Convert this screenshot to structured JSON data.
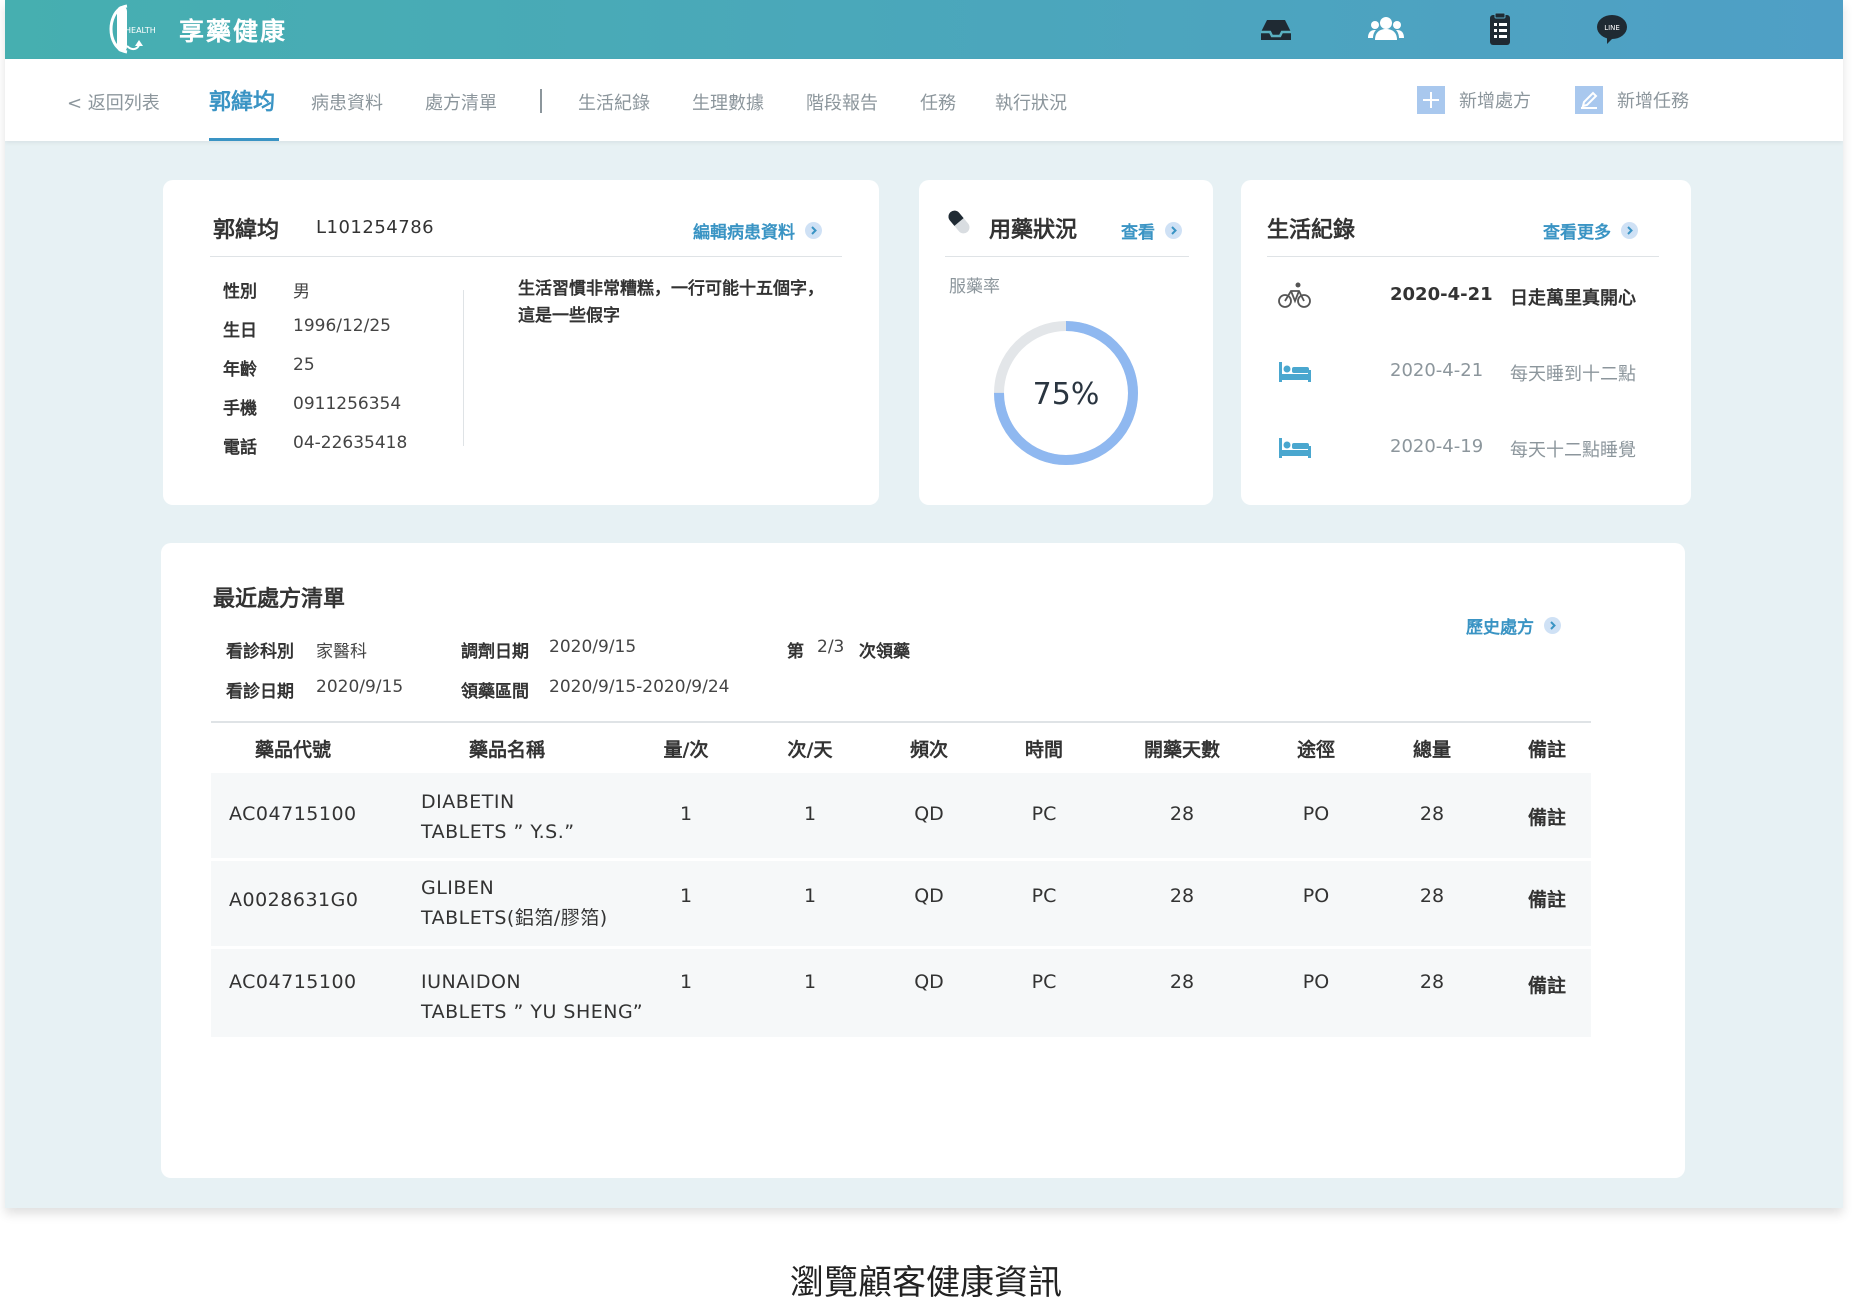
{
  "header": {
    "brand": "享藥健康",
    "logo_text": "HEALTH",
    "icons": [
      "inbox-icon",
      "users-icon",
      "clipboard-icon",
      "line-chat-icon"
    ],
    "line_badge": "LINE"
  },
  "nav": {
    "back": "< 返回列表",
    "tabs": {
      "patient": "郭緯均",
      "profile": "病患資料",
      "rx_list": "處方清單",
      "life": "生活紀錄",
      "physio": "生理數據",
      "report": "階段報告",
      "task": "任務",
      "status": "執行狀況"
    },
    "actions": {
      "add_rx": "新增處方",
      "add_task": "新增任務"
    }
  },
  "patient": {
    "name": "郭緯均",
    "id": "L101254786",
    "edit_link": "編輯病患資料",
    "fields": [
      {
        "label": "性別",
        "value": "男"
      },
      {
        "label": "生日",
        "value": "1996/12/25"
      },
      {
        "label": "年齡",
        "value": "25"
      },
      {
        "label": "手機",
        "value": "0911256354"
      },
      {
        "label": "電話",
        "value": "04-22635418"
      }
    ],
    "note": "生活習慣非常糟糕，一行可能十五個字，這是一些假字"
  },
  "medication": {
    "title": "用藥狀況",
    "view_link": "查看",
    "rate_label": "服藥率",
    "rate_text": "75%",
    "rate_value": 75,
    "ring_color": "#8fb8f0",
    "track_color": "#e3e6e9"
  },
  "life_log": {
    "title": "生活紀錄",
    "more_link": "查看更多",
    "entries": [
      {
        "icon": "bicycle-icon",
        "date": "2020-4-21",
        "text": "日走萬里真開心"
      },
      {
        "icon": "bed-icon",
        "date": "2020-4-21",
        "text": "每天睡到十二點"
      },
      {
        "icon": "bed-icon",
        "date": "2020-4-19",
        "text": "每天十二點睡覺"
      }
    ]
  },
  "prescription": {
    "title": "最近處方清單",
    "history_link": "歷史處方",
    "meta": {
      "dept_label": "看診科別",
      "dept_value": "家醫科",
      "visit_label": "看診日期",
      "visit_value": "2020/9/15",
      "dispense_label": "調劑日期",
      "dispense_value": "2020/9/15",
      "period_label": "領藥區間",
      "period_value": "2020/9/15-2020/9/24",
      "refill_prefix": "第",
      "refill_value": "2/3",
      "refill_suffix": "次領藥"
    },
    "columns": [
      "藥品代號",
      "藥品名稱",
      "量/次",
      "次/天",
      "頻次",
      "時間",
      "開藥天數",
      "途徑",
      "總量",
      "備註"
    ],
    "rows": [
      {
        "code": "AC04715100",
        "name1": "DIABETIN",
        "name2": "TABLETS ” Y.S.”",
        "dose": "1",
        "times": "1",
        "freq": "QD",
        "time": "PC",
        "days": "28",
        "route": "PO",
        "total": "28",
        "remark": "備註"
      },
      {
        "code": "A0028631G0",
        "name1": "GLIBEN",
        "name2": "TABLETS(鋁箔/膠箔)",
        "dose": "1",
        "times": "1",
        "freq": "QD",
        "time": "PC",
        "days": "28",
        "route": "PO",
        "total": "28",
        "remark": "備註"
      },
      {
        "code": "AC04715100",
        "name1": "IUNAIDON",
        "name2": "TABLETS ” YU SHENG”",
        "dose": "1",
        "times": "1",
        "freq": "QD",
        "time": "PC",
        "days": "28",
        "route": "PO",
        "total": "28",
        "remark": "備註"
      }
    ]
  },
  "caption": "瀏覽顧客健康資訊"
}
